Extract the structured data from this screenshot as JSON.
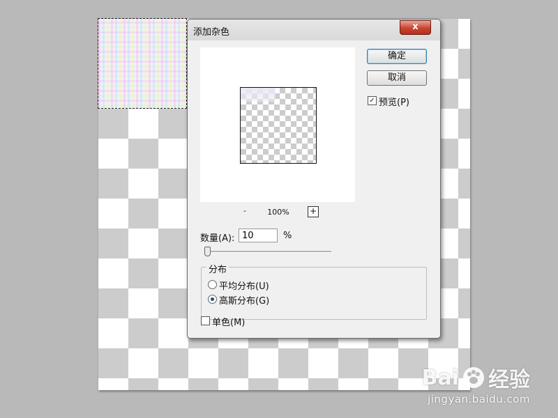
{
  "dialog": {
    "title": "添加杂色",
    "close_label": "x",
    "ok_label": "确定",
    "cancel_label": "取消",
    "preview_label": "预览(P)",
    "preview_checked": true,
    "zoom_minus": "-",
    "zoom_level": "100%",
    "zoom_plus": "+",
    "amount_label": "数量(A):",
    "amount_value": "10",
    "amount_unit": "%",
    "distribution_label": "分布",
    "uniform_label": "平均分布(U)",
    "gaussian_label": "高斯分布(G)",
    "selected_distribution": "gaussian",
    "monochrome_label": "单色(M)",
    "monochrome_checked": false
  },
  "watermark": {
    "brand": "Bai",
    "brand_suffix": "经验",
    "url": "jingyan.baidu.com"
  }
}
